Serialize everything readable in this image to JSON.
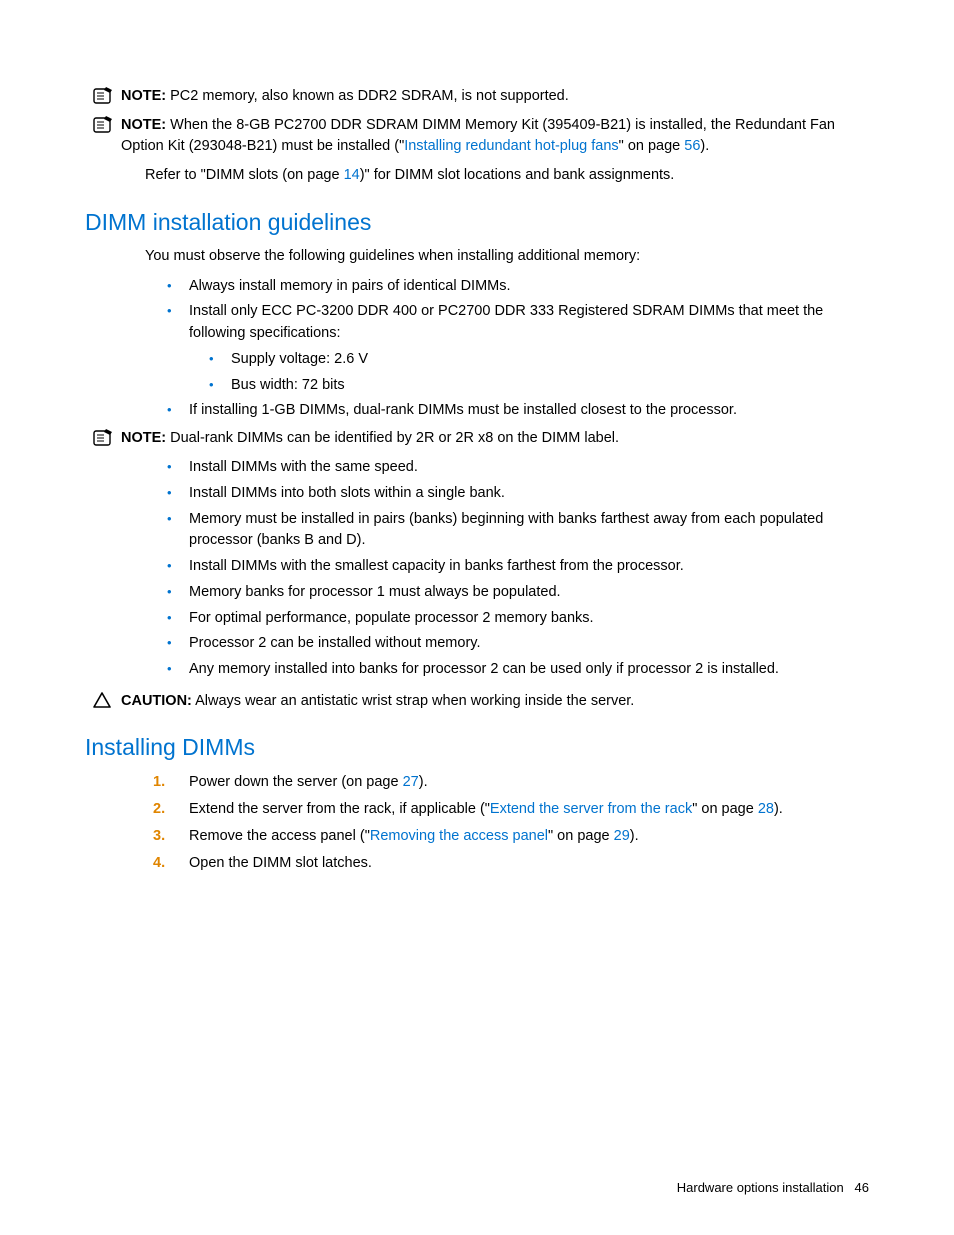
{
  "notes": {
    "note1_label": "NOTE:",
    "note1_text": "  PC2 memory, also known as DDR2 SDRAM, is not supported.",
    "note2_label": "NOTE:",
    "note2_text_a": "  When the 8-GB PC2700 DDR SDRAM DIMM Memory Kit (395409-B21) is installed, the Redundant Fan Option Kit (293048-B21) must be installed (\"",
    "note2_link": "Installing redundant hot-plug fans",
    "note2_text_b": "\" on page ",
    "note2_page": "56",
    "note2_text_c": ").",
    "note3_label": "NOTE:",
    "note3_text": "  Dual-rank DIMMs can be identified by 2R or 2R x8 on the DIMM label.",
    "caution_label": "CAUTION:",
    "caution_text": "  Always wear an antistatic wrist strap when working inside the server."
  },
  "refer": {
    "a": "Refer to \"DIMM slots (on page ",
    "page": "14",
    "b": ")\" for DIMM slot locations and bank assignments."
  },
  "headings": {
    "h1": "DIMM installation guidelines",
    "h2": "Installing DIMMs"
  },
  "intro": "You must observe the following guidelines when installing additional memory:",
  "bullets1": [
    "Always install memory in pairs of identical DIMMs.",
    "Install only ECC PC-3200 DDR 400 or PC2700 DDR 333 Registered SDRAM DIMMs that meet the following specifications:"
  ],
  "subbullets": [
    "Supply voltage: 2.6 V",
    "Bus width: 72 bits"
  ],
  "bullets1b": [
    "If installing 1-GB DIMMs, dual-rank DIMMs must be installed closest to the processor."
  ],
  "bullets2": [
    "Install DIMMs with the same speed.",
    "Install DIMMs into both slots within a single bank.",
    "Memory must be installed in pairs (banks) beginning with banks farthest away from each populated processor (banks B and D).",
    "Install DIMMs with the smallest capacity in banks farthest from the processor.",
    "Memory banks for processor 1 must always be populated.",
    "For optimal performance, populate processor 2 memory banks.",
    "Processor 2 can be installed without memory.",
    "Any memory installed into banks for processor 2 can be used only if processor 2 is installed."
  ],
  "steps": {
    "s1_a": "Power down the server (on page ",
    "s1_page": "27",
    "s1_b": ").",
    "s2_a": "Extend the server from the rack, if applicable (\"",
    "s2_link": "Extend the server from the rack",
    "s2_b": "\" on page ",
    "s2_page": "28",
    "s2_c": ").",
    "s3_a": "Remove the access panel (\"",
    "s3_link": "Removing the access panel",
    "s3_b": "\" on page ",
    "s3_page": "29",
    "s3_c": ").",
    "s4": "Open the DIMM slot latches."
  },
  "footer": {
    "title": "Hardware options installation",
    "page": "46"
  }
}
